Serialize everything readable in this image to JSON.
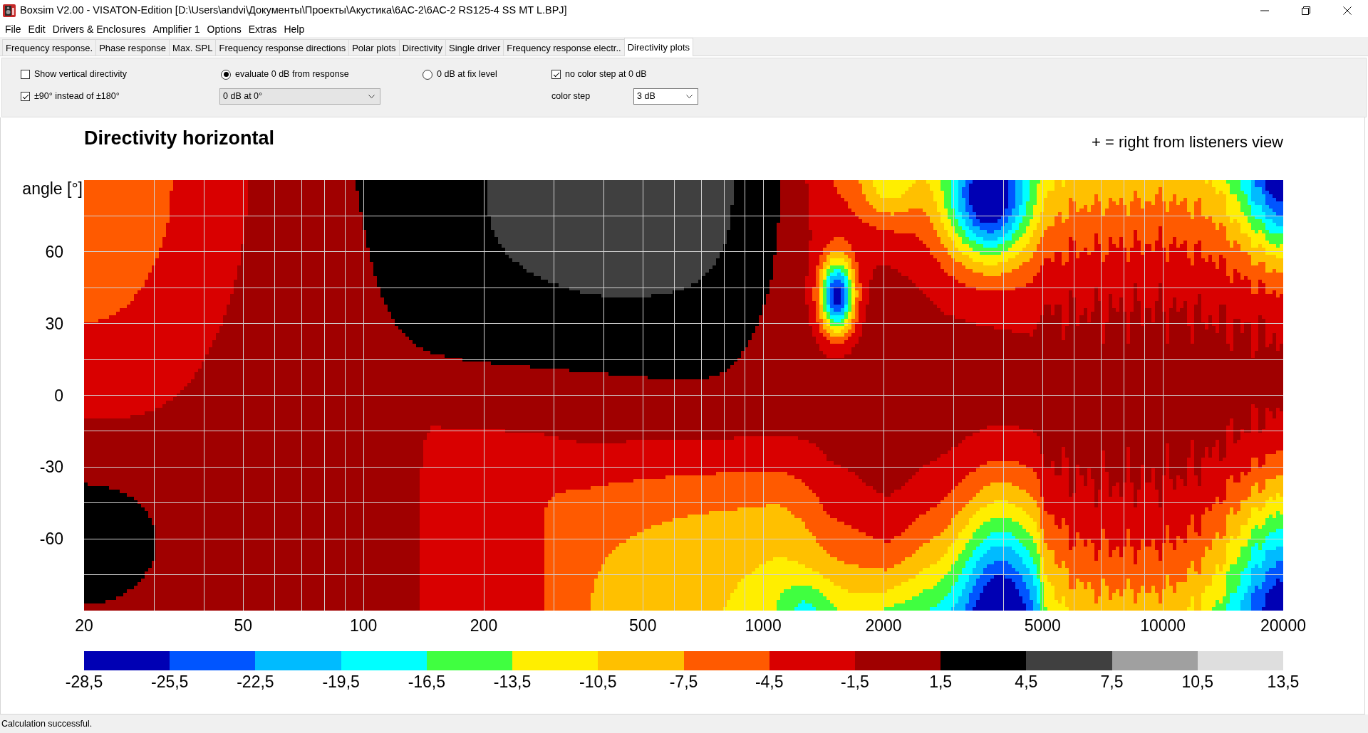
{
  "window": {
    "title": "Boxsim V2.00 - VISATON-Edition [D:\\Users\\andvi\\Документы\\Проекты\\Акустика\\6АС-2\\6АС-2 RS125-4 SS MT L.BPJ]"
  },
  "menu": [
    "File",
    "Edit",
    "Drivers & Enclosures",
    "Amplifier 1",
    "Options",
    "Extras",
    "Help"
  ],
  "tabs": [
    {
      "label": "Frequency response.",
      "selected": false
    },
    {
      "label": "Phase response",
      "selected": false
    },
    {
      "label": "Max. SPL",
      "selected": false
    },
    {
      "label": "Frequency response directions",
      "selected": false
    },
    {
      "label": "Polar plots",
      "selected": false
    },
    {
      "label": "Directivity",
      "selected": false
    },
    {
      "label": "Single driver",
      "selected": false
    },
    {
      "label": "Frequency response electr..",
      "selected": false
    },
    {
      "label": "Directivity plots",
      "selected": true
    }
  ],
  "options": {
    "groups": [
      {
        "items": [
          {
            "kind": "checkbox",
            "label": "Show vertical directivity",
            "checked": false
          },
          {
            "kind": "checkbox",
            "label": "±90° instead of ±180°",
            "checked": true
          }
        ]
      },
      {
        "items": [
          {
            "kind": "radio",
            "label": "evaluate 0 dB from response",
            "selected": true
          },
          {
            "kind": "dropdown",
            "value": "0 dB at 0°"
          }
        ]
      },
      {
        "items": [
          {
            "kind": "radio",
            "label": "0 dB at fix level",
            "selected": false
          }
        ]
      },
      {
        "items": [
          {
            "kind": "checkbox",
            "label": "no color step at 0 dB",
            "checked": true
          },
          {
            "kind": "combobox",
            "label": "color step",
            "value": "3 dB"
          }
        ]
      }
    ]
  },
  "chart": {
    "title": "Directivity horizontal",
    "note": "+ = right from listeners view",
    "y_axis_label": "angle [°]",
    "y_ticks": [
      "60",
      "30",
      "0",
      "-30",
      "-60"
    ],
    "x_ticks": [
      "20",
      "50",
      "100",
      "200",
      "500",
      "1000",
      "2000",
      "5000",
      "10000",
      "20000"
    ]
  },
  "legend": {
    "bins": [
      {
        "color": "#0000b4"
      },
      {
        "color": "#0055ff"
      },
      {
        "color": "#00bbff"
      },
      {
        "color": "#00ffff"
      },
      {
        "color": "#40ff40"
      },
      {
        "color": "#ffee00"
      },
      {
        "color": "#ffc000"
      },
      {
        "color": "#ff5a00"
      },
      {
        "color": "#d90000"
      },
      {
        "color": "#a00000"
      },
      {
        "color": "#000000"
      },
      {
        "color": "#404040"
      },
      {
        "color": "#a0a0a0"
      },
      {
        "color": "#dedede"
      }
    ],
    "labels": [
      "-28,5",
      "-25,5",
      "-22,5",
      "-19,5",
      "-16,5",
      "-13,5",
      "-10,5",
      "-7,5",
      "-4,5",
      "-1,5",
      "1,5",
      "4,5",
      "7,5",
      "10,5",
      "13,5"
    ]
  },
  "status_bar": "Calculation successful."
}
